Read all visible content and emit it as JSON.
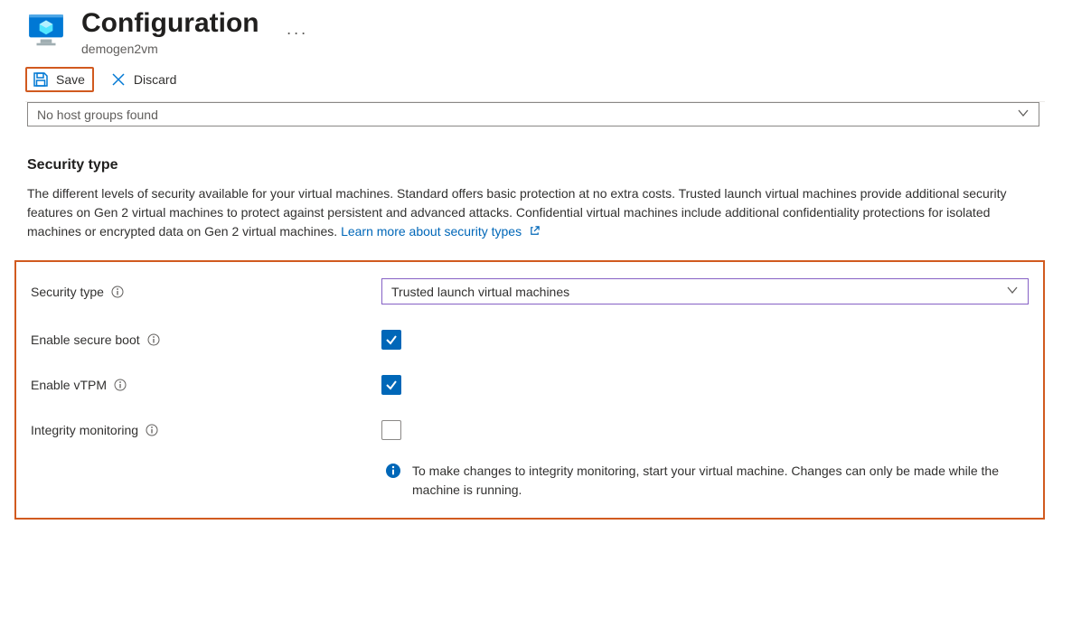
{
  "header": {
    "title": "Configuration",
    "subtitle": "demogen2vm"
  },
  "toolbar": {
    "save_label": "Save",
    "discard_label": "Discard"
  },
  "host_group_dropdown": {
    "placeholder": "No host groups found"
  },
  "security": {
    "heading": "Security type",
    "description_text": "The different levels of security available for your virtual machines. Standard offers basic protection at no extra costs. Trusted launch virtual machines provide additional security features on Gen 2 virtual machines to protect against persistent and advanced attacks. Confidential virtual machines include additional confidentiality protections for isolated machines or encrypted data on Gen 2 virtual machines.",
    "learn_more_link": "Learn more about security types",
    "fields": {
      "security_type_label": "Security type",
      "security_type_value": "Trusted launch virtual machines",
      "secure_boot_label": "Enable secure boot",
      "secure_boot_checked": true,
      "vtpm_label": "Enable vTPM",
      "vtpm_checked": true,
      "integrity_label": "Integrity monitoring",
      "integrity_checked": false
    },
    "note": "To make changes to integrity monitoring, start your virtual machine. Changes can only be made while the machine is running."
  }
}
